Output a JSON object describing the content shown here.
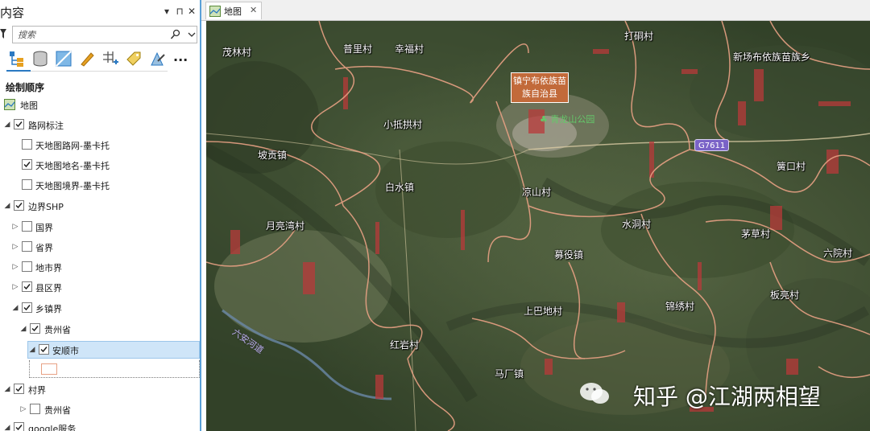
{
  "pane": {
    "title": "内容",
    "controls": {
      "menu": "▾",
      "pin": "⊓",
      "close": "✕"
    },
    "search_placeholder": "搜索",
    "section_title": "绘制顺序",
    "tools": [
      "list-by-drawing-order-icon",
      "list-by-source-icon",
      "list-by-selection-icon",
      "list-by-editing-icon",
      "list-by-snapping-icon",
      "list-by-labeling-icon",
      "list-by-perspective-icon",
      "more-icon"
    ],
    "more_label": "...",
    "layers": [
      {
        "label": "地图",
        "type": "map"
      },
      {
        "label": "路网标注",
        "expanded": true,
        "checked": true
      },
      {
        "label": "天地图路网-墨卡托",
        "checked": false
      },
      {
        "label": "天地图地名-墨卡托",
        "checked": true
      },
      {
        "label": "天地图境界-墨卡托",
        "checked": false
      },
      {
        "label": "边界SHP",
        "expanded": true,
        "checked": true
      },
      {
        "label": "国界",
        "expanded": false,
        "checked": false
      },
      {
        "label": "省界",
        "expanded": false,
        "checked": false
      },
      {
        "label": "地市界",
        "expanded": false,
        "checked": false
      },
      {
        "label": "县区界",
        "expanded": false,
        "checked": true
      },
      {
        "label": "乡镇界",
        "expanded": true,
        "checked": true
      },
      {
        "label": "贵州省",
        "expanded": true,
        "checked": true
      },
      {
        "label": "安顺市",
        "expanded": true,
        "checked": true,
        "selected": true
      },
      {
        "label": "村界",
        "expanded": true,
        "checked": true
      },
      {
        "label": "贵州省",
        "expanded": false,
        "checked": false
      },
      {
        "label": "google服务",
        "expanded": true,
        "checked": true
      }
    ],
    "symbol_color": "#e8a184"
  },
  "map": {
    "tab_label": "地图",
    "tab_close": "✕",
    "county_label": "镇宁布依族苗族自治县",
    "road_shield": "G7611",
    "river_label": "六安河道",
    "park_label": "青龙山公园",
    "places": [
      "茂林村",
      "普里村",
      "幸福村",
      "打硐村",
      "新场布依族苗族乡",
      "小抵拱村",
      "坡贡镇",
      "白水镇",
      "凉山村",
      "簧口村",
      "月亮湾村",
      "水洞村",
      "茅草村",
      "六院村",
      "募役镇",
      "板亮村",
      "锦绣村",
      "上巴地村",
      "红岩村",
      "马厂镇"
    ],
    "watermark": "知乎 @江湖两相望",
    "colors": {
      "boundary": "#e8a184",
      "label_bg": "#c26a3a",
      "shield": "#7a63c7"
    }
  }
}
